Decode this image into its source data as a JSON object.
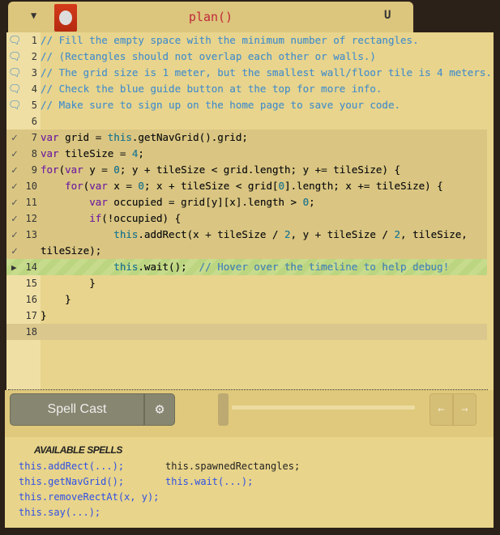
{
  "header": {
    "title": "plan()",
    "collapse_icon": "chevron-down-icon",
    "magnet_icon": "magnet-icon"
  },
  "editor": {
    "lines": [
      {
        "n": "1",
        "text": "// Fill the empty space with the minimum number of rectangles.",
        "marker": "comment"
      },
      {
        "n": "2",
        "text": "// (Rectangles should not overlap each other or walls.)",
        "marker": "comment"
      },
      {
        "n": "3",
        "text": "// The grid size is 1 meter, but the smallest wall/floor tile is 4 meters.",
        "marker": "comment"
      },
      {
        "n": "4",
        "text": "// Check the blue guide button at the top for more info.",
        "marker": "comment"
      },
      {
        "n": "5",
        "text": "// Make sure to sign up on the home page to save your code.",
        "marker": "comment"
      },
      {
        "n": "6",
        "text": "",
        "marker": ""
      },
      {
        "n": "7",
        "text": "var grid = this.getNavGrid().grid;",
        "marker": "check",
        "state": "exec"
      },
      {
        "n": "8",
        "text": "var tileSize = 4;",
        "marker": "check",
        "state": "exec"
      },
      {
        "n": "9",
        "text": "for(var y = 0; y + tileSize < grid.length; y += tileSize) {",
        "marker": "check",
        "state": "exec"
      },
      {
        "n": "10",
        "text": "    for(var x = 0; x + tileSize < grid[0].length; x += tileSize) {",
        "marker": "check",
        "state": "exec"
      },
      {
        "n": "11",
        "text": "        var occupied = grid[y][x].length > 0;",
        "marker": "check",
        "state": "exec"
      },
      {
        "n": "12",
        "text": "        if(!occupied) {",
        "marker": "check",
        "state": "exec"
      },
      {
        "n": "13",
        "text": "            this.addRect(x + tileSize / 2, y + tileSize / 2, tileSize,",
        "marker": "check",
        "state": "exec"
      },
      {
        "n": "",
        "text": "tileSize);",
        "marker": "check",
        "state": "exec"
      },
      {
        "n": "14",
        "text": "            this.wait();  // Hover over the timeline to help debug!",
        "marker": "play",
        "state": "cur"
      },
      {
        "n": "15",
        "text": "        }",
        "marker": ""
      },
      {
        "n": "16",
        "text": "    }",
        "marker": ""
      },
      {
        "n": "17",
        "text": "}",
        "marker": ""
      },
      {
        "n": "18",
        "text": "",
        "marker": "",
        "state": "act"
      }
    ]
  },
  "controls": {
    "spell_cast": "Spell Cast",
    "settings_icon": "gear-icon",
    "prev_icon": "arrow-left-icon",
    "next_icon": "arrow-right-icon",
    "timeline_progress": 0
  },
  "spells": {
    "title": "AVAILABLE SPELLS",
    "col1": [
      "this.addRect(...);",
      "this.getNavGrid();",
      "this.removeRectAt(x, y);",
      "this.say(...);"
    ],
    "col2": [
      "this.spawnedRectangles;",
      "this.wait(...);"
    ]
  }
}
